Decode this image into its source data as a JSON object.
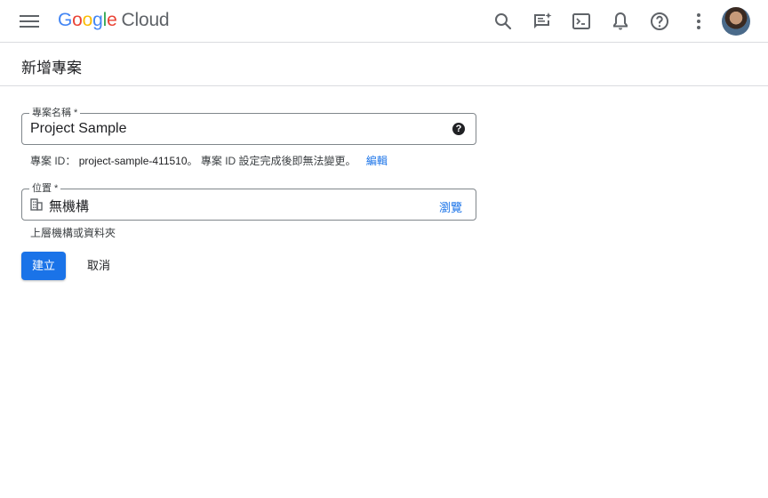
{
  "header": {
    "logo_letters": [
      "G",
      "o",
      "o",
      "g",
      "l",
      "e"
    ],
    "logo_product": "Cloud"
  },
  "page": {
    "title": "新增專案"
  },
  "form": {
    "project_name": {
      "label": "專案名稱 *",
      "value": "Project Sample",
      "help_glyph": "?"
    },
    "project_id_hint": {
      "prefix": "專案 ID：",
      "id": "project-sample-411510",
      "suffix": "。 專案 ID 設定完成後即無法變更。",
      "edit_link": "編輯"
    },
    "location": {
      "label": "位置 *",
      "value": "無機構",
      "browse_link": "瀏覽",
      "hint": "上層機構或資料夾"
    }
  },
  "actions": {
    "create_label": "建立",
    "cancel_label": "取消"
  },
  "colors": {
    "accent": "#1a73e8",
    "divider": "#dadce0",
    "icon": "#5f6368"
  },
  "icons": [
    "menu-icon",
    "search-icon",
    "gemini-assist-icon",
    "cloud-shell-icon",
    "notifications-icon",
    "help-icon",
    "more-vert-icon",
    "organization-icon"
  ]
}
